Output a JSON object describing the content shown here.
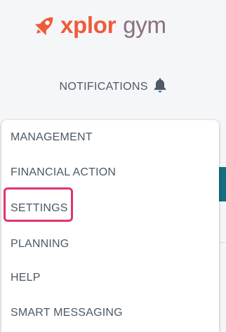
{
  "brand": {
    "name_part1": "xplor",
    "name_part2": "gym",
    "logo_icon": "rocket-icon",
    "colors": {
      "primary": "#ef5a3a",
      "secondary": "#8a6f80"
    }
  },
  "header": {
    "notifications_label": "NOTIFICATIONS",
    "notifications_icon": "bell-icon"
  },
  "menu": {
    "items": [
      {
        "label": "MANAGEMENT"
      },
      {
        "label": "FINANCIAL ACTION"
      },
      {
        "label": "SETTINGS",
        "highlighted": true
      },
      {
        "label": "PLANNING"
      },
      {
        "label": "HELP"
      },
      {
        "label": "SMART MESSAGING"
      }
    ]
  },
  "colors": {
    "highlight_border": "#e0356d",
    "accent_teal": "#156d80",
    "menu_text": "#4d5964"
  }
}
